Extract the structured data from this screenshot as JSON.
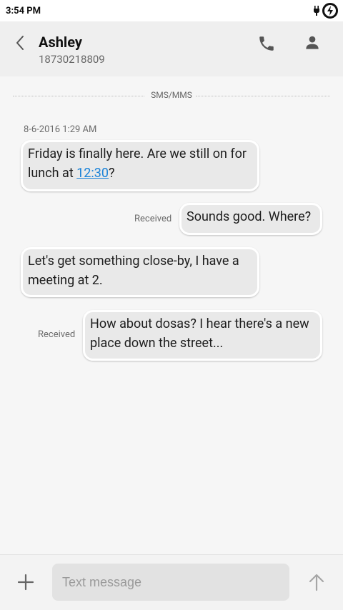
{
  "status_bar": {
    "time": "3:54 PM",
    "icons": [
      "charging-plug-icon",
      "battery-charging-icon"
    ]
  },
  "header": {
    "contact_name": "Ashley",
    "contact_number": "18730218809",
    "icons": [
      "back-arrow-icon",
      "phone-icon",
      "person-icon"
    ]
  },
  "conversation": {
    "divider_label": "SMS/MMS",
    "timestamp": "8-6-2016 1:29 AM",
    "messages": [
      {
        "text_before": "Friday is finally here. Are we still on for lunch at ",
        "link": "12:30",
        "text_after": "?"
      },
      {
        "text": "Sounds good. Where?",
        "status": "Received"
      },
      {
        "text": "Let's get something close-by, I have a meeting at 2."
      },
      {
        "text": "How about dosas? I hear there's a new place down the street...",
        "status": "Received"
      }
    ]
  },
  "composer": {
    "placeholder": "Text message",
    "icons": [
      "add-icon",
      "send-arrow-icon"
    ]
  },
  "colors": {
    "bubble_bg": "#e9e9e9",
    "link": "#1a82d8",
    "header_bg": "#efefef"
  }
}
